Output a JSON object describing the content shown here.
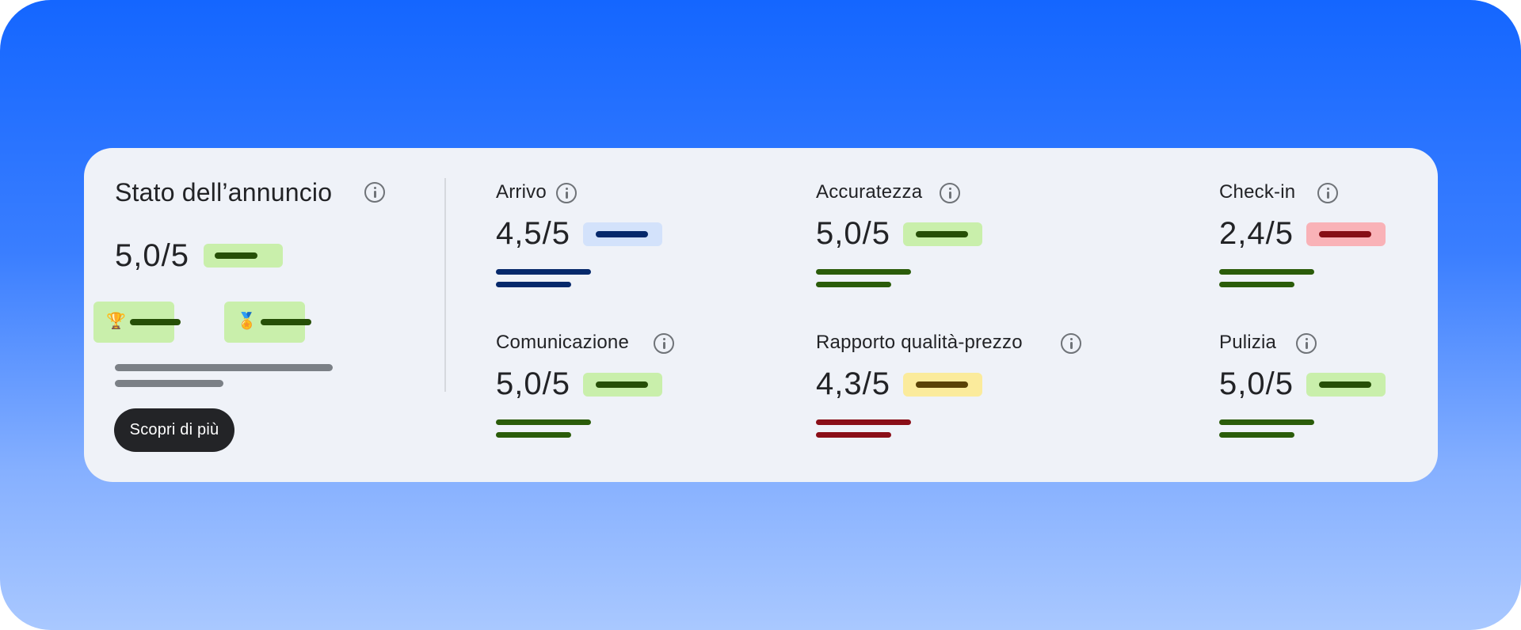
{
  "summary": {
    "title": "Stato dell’annuncio",
    "score": "5,0/5",
    "pill_color": "#c9efab",
    "pill_line_color": "#264f07",
    "badges": [
      {
        "icon": "trophy-icon",
        "glyph": "🏆"
      },
      {
        "icon": "medal-icon",
        "glyph": "🏅"
      }
    ],
    "cta_label": "Scopri di più"
  },
  "metrics": [
    {
      "label": "Arrivo",
      "score": "4,5/5",
      "pill_bg": "#d3e2fb",
      "line_color": "#06296b",
      "bar_color": "#06296b"
    },
    {
      "label": "Accuratezza",
      "score": "5,0/5",
      "pill_bg": "#c9efab",
      "line_color": "#264f07",
      "bar_color": "#2b5c0a"
    },
    {
      "label": "Check-in",
      "score": "2,4/5",
      "pill_bg": "#f9b2b7",
      "line_color": "#860e15",
      "bar_color": "#2b5c0a"
    },
    {
      "label": "Comunicazione",
      "score": "5,0/5",
      "pill_bg": "#c9efab",
      "line_color": "#264f07",
      "bar_color": "#2b5c0a"
    },
    {
      "label": "Rapporto qualità-prezzo",
      "score": "4,3/5",
      "pill_bg": "#fbeb9c",
      "line_color": "#5a4206",
      "bar_color": "#8a0f18"
    },
    {
      "label": "Pulizia",
      "score": "5,0/5",
      "pill_bg": "#c9efab",
      "line_color": "#264f07",
      "bar_color": "#2b5c0a"
    }
  ]
}
